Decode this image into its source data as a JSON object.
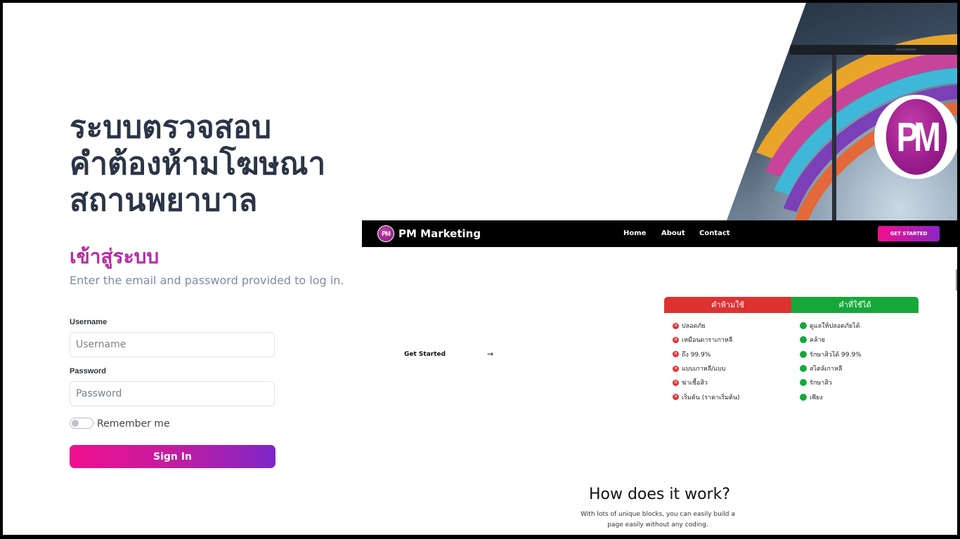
{
  "title": {
    "line1": "ระบบตรวจสอบ",
    "line2": "คำต้องห้ามโฆษณา",
    "line3": "สถานพยาบาล"
  },
  "badge": {
    "text": "PM"
  },
  "login": {
    "heading": "เข้าสู่ระบบ",
    "subtitle": "Enter the email and password provided to log in.",
    "username_label": "Username",
    "username_placeholder": "Username",
    "password_label": "Password",
    "password_placeholder": "Password",
    "remember_label": "Remember me",
    "remember_on": false,
    "signin_label": "Sign In"
  },
  "site_preview": {
    "logo_text": "PM",
    "brand": "PM Marketing",
    "nav": [
      "Home",
      "About",
      "Contact"
    ],
    "cta": "GET STARTED",
    "get_started": "Get Started",
    "arrow": "→",
    "compare": {
      "forbidden_header": "คำห้ามใช้",
      "allowed_header": "คำที่ใช้ได้",
      "forbidden": [
        "ปลอดภัย",
        "เหมือนดาราเกาหลี",
        "ถึง 99.9%",
        "แบบเกาหลี/แบบ",
        "ฆ่าเชื้อสิว",
        "เริ่มต้น (ราคาเริ่มต้น)"
      ],
      "allowed": [
        "ดูแลให้ปลอดภัยได้",
        "คล้าย",
        "รักษาสิวได้ 99.9%",
        "สไตล์เกาหลี",
        "รักษาสิว",
        "เพียง"
      ],
      "forbidden_color": "#e03131",
      "allowed_color": "#16a83a"
    },
    "how_title": "How does it work?",
    "how_sub": "With lots of unique blocks, you can easily build a page easily without any coding."
  },
  "colors": {
    "accent_pink": "#f00f8e",
    "accent_purple": "#7c27c9",
    "heading_magenta": "#b82aa4",
    "title_dark": "#2a3546"
  }
}
